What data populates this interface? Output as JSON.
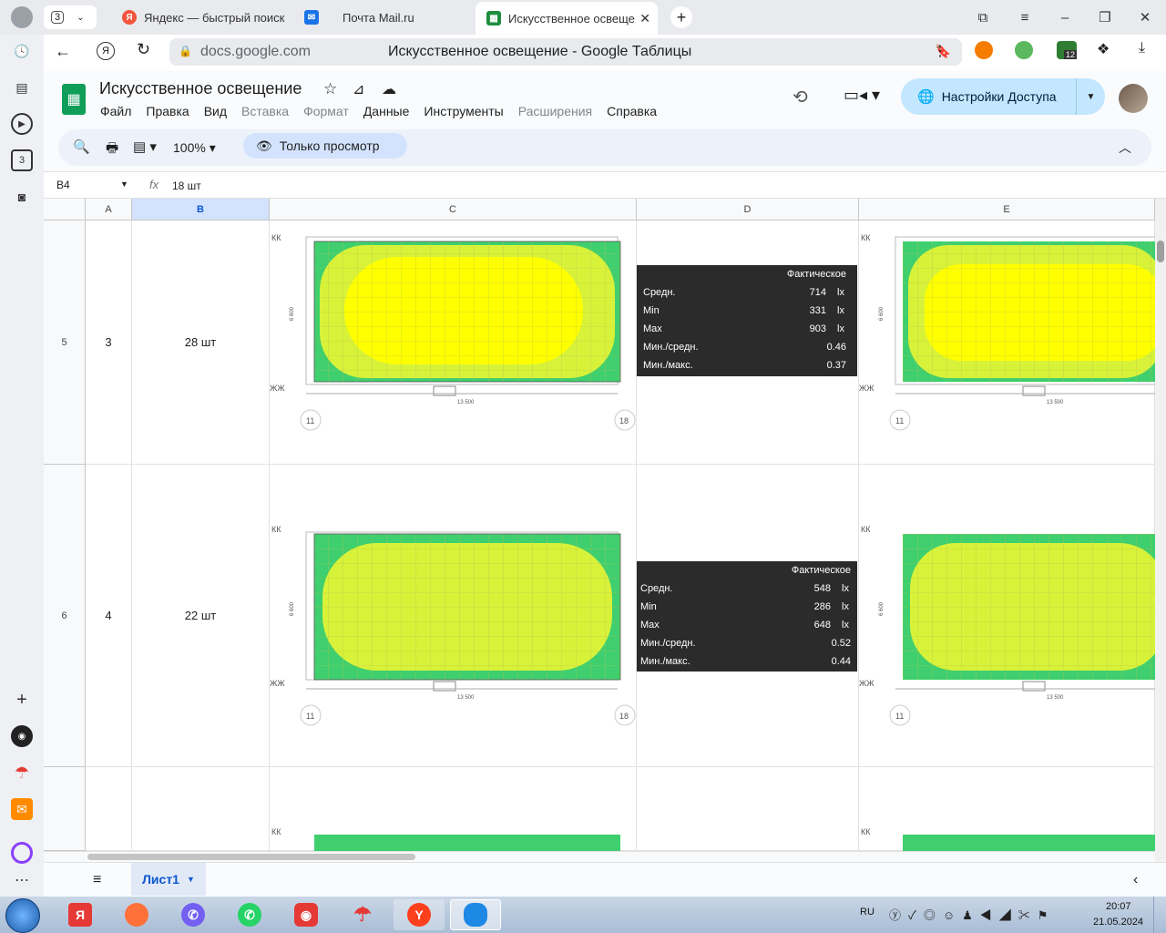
{
  "browser": {
    "tab_count": "3",
    "tabs": [
      {
        "title": "Яндекс — быстрый поиск",
        "icon": "yandex-icon",
        "color": "#f2543d",
        "glyph": "Я"
      },
      {
        "title": "Почта Mail.ru",
        "icon": "mail-icon",
        "color": "#1a73e8",
        "glyph": "✉"
      },
      {
        "title": "Искусственное освеще",
        "icon": "sheets-icon",
        "color": "#1e8e3e",
        "glyph": "▦"
      }
    ],
    "url_domain": "docs.google.com",
    "page_title": "Искусственное освещение - Google Таблицы",
    "ext_badge": "12",
    "sidebar_badge": "3"
  },
  "doc": {
    "title": "Искусственное освещение",
    "menu": [
      {
        "label": "Файл",
        "enabled": true
      },
      {
        "label": "Правка",
        "enabled": true
      },
      {
        "label": "Вид",
        "enabled": true
      },
      {
        "label": "Вставка",
        "enabled": false
      },
      {
        "label": "Формат",
        "enabled": false
      },
      {
        "label": "Данные",
        "enabled": true
      },
      {
        "label": "Инструменты",
        "enabled": true
      },
      {
        "label": "Расширения",
        "enabled": false
      },
      {
        "label": "Справка",
        "enabled": true
      }
    ],
    "share_label": "Настройки Доступа",
    "zoom": "100%",
    "view_only": "Только просмотр"
  },
  "formula_bar": {
    "cell_ref": "B4",
    "fx": "fx",
    "value": "18 шт"
  },
  "grid": {
    "columns": [
      "A",
      "B",
      "C",
      "D",
      "E"
    ],
    "selected_column": "B",
    "rows": [
      {
        "row": "5",
        "a": "3",
        "b": "28 шт"
      },
      {
        "row": "6",
        "a": "4",
        "b": "22 шт"
      }
    ],
    "plan": {
      "kk": "КК",
      "zhk": "ЖЖ",
      "width": "13 500",
      "height": "6 600",
      "axis_left": "11",
      "axis_right": "18"
    },
    "stats": [
      {
        "header": "Фактическое",
        "rows": [
          {
            "label": "Средн.",
            "value": "714",
            "unit": "lx"
          },
          {
            "label": "Min",
            "value": "331",
            "unit": "lx"
          },
          {
            "label": "Max",
            "value": "903",
            "unit": "lx"
          },
          {
            "label": "Мин./средн.",
            "value": "0.46",
            "unit": ""
          },
          {
            "label": "Мин./макс.",
            "value": "0.37",
            "unit": ""
          }
        ]
      },
      {
        "header": "Фактическое",
        "rows": [
          {
            "label": "Средн.",
            "value": "548",
            "unit": "lx"
          },
          {
            "label": "Min",
            "value": "286",
            "unit": "lx"
          },
          {
            "label": "Max",
            "value": "648",
            "unit": "lx"
          },
          {
            "label": "Мин./средн.",
            "value": "0.52",
            "unit": ""
          },
          {
            "label": "Мин./макс.",
            "value": "0.44",
            "unit": ""
          }
        ]
      }
    ]
  },
  "sheet_tab": "Лист1",
  "tray": {
    "lang": "RU",
    "time": "20:07",
    "date": "21.05.2024"
  },
  "colors": {
    "accent": "#0b57d0",
    "share_bg": "#c2e7ff",
    "sheets_green": "#0f9d58",
    "heat_yellow": "#ffff00",
    "heat_lime": "#d8f23a",
    "heat_green": "#3fcf6e"
  }
}
